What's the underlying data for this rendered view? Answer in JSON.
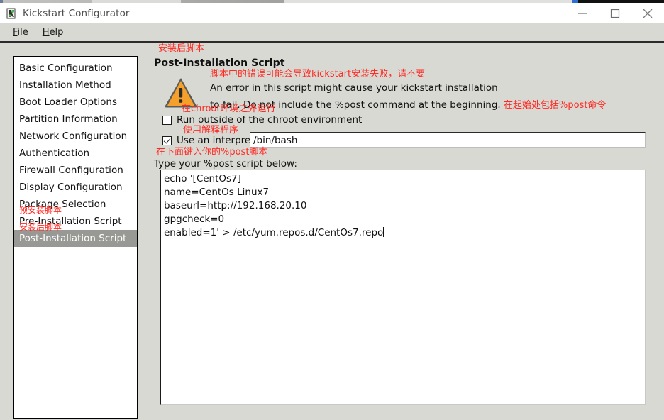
{
  "window": {
    "title": "Kickstart Configurator",
    "app_icon": "kickstart-icon",
    "minimize_label": "Minimize",
    "maximize_label": "Maximize",
    "close_label": "Close"
  },
  "menubar": {
    "items": [
      {
        "label": "File",
        "mnemonic": "F"
      },
      {
        "label": "Help",
        "mnemonic": "H"
      }
    ]
  },
  "sidebar": {
    "items": [
      {
        "label": "Basic Configuration",
        "selected": false,
        "annotation": ""
      },
      {
        "label": "Installation Method",
        "selected": false,
        "annotation": ""
      },
      {
        "label": "Boot Loader Options",
        "selected": false,
        "annotation": ""
      },
      {
        "label": "Partition Information",
        "selected": false,
        "annotation": ""
      },
      {
        "label": "Network Configuration",
        "selected": false,
        "annotation": ""
      },
      {
        "label": "Authentication",
        "selected": false,
        "annotation": ""
      },
      {
        "label": "Firewall Configuration",
        "selected": false,
        "annotation": ""
      },
      {
        "label": "Display Configuration",
        "selected": false,
        "annotation": ""
      },
      {
        "label": "Package Selection",
        "selected": false,
        "annotation": ""
      },
      {
        "label": "Pre-Installation Script",
        "selected": false,
        "annotation": "预安装脚本"
      },
      {
        "label": "Post-Installation Script",
        "selected": true,
        "annotation": "安装后脚本"
      }
    ]
  },
  "panel": {
    "top_annotation": "安装后脚本",
    "title": "Post-Installation Script",
    "warning": {
      "icon": "warning-triangle-icon",
      "annotation_top": "脚本中的错误可能会导致kickstart安装失败，请不要",
      "line1": "An error in this script might cause your kickstart installation",
      "line2": "to fail. Do not include the %post command at the beginning.",
      "line2_annotation": "在起始处包括%post命令"
    },
    "chroot_checkbox": {
      "label": "Run outside of the chroot environment",
      "annotation": "在chroot环境之外运行",
      "checked": false
    },
    "interpreter_checkbox": {
      "label": "Use an interpreter:",
      "annotation": "使用解释程序",
      "checked": true
    },
    "interpreter_input": {
      "value": "/bin/bash",
      "placeholder": ""
    },
    "script_label": "Type your %post script below:",
    "script_label_annotation": "在下面键入你的%post脚本",
    "script_lines": [
      "echo '[CentOs7]",
      "name=CentOs Linux7",
      "baseurl=http://192.168.20.10",
      "gpgcheck=0",
      "enabled=1' > /etc/yum.repos.d/CentOs7.repo"
    ]
  },
  "colors": {
    "background": "#d9d9d3",
    "titlebar": "#ffffff",
    "selection": "#989894",
    "annotation_red": "#ff2a23",
    "warning_orange": "#f5a02a"
  }
}
